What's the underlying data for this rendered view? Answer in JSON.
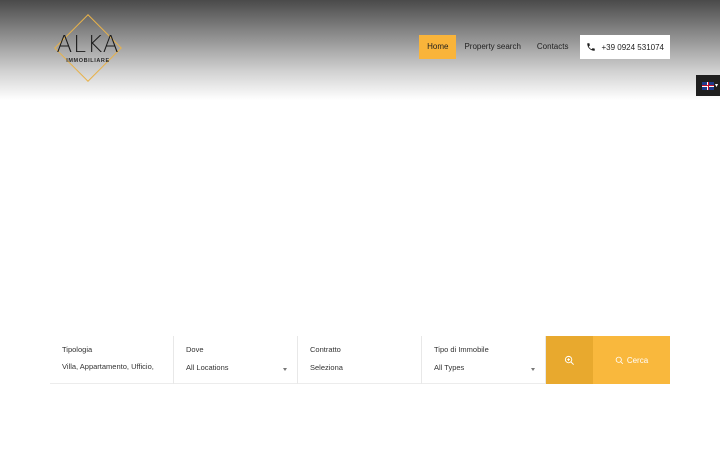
{
  "brand": {
    "name": "ALKA",
    "subtitle": "IMMOBILIARE",
    "accent": "#f9b43a"
  },
  "nav": {
    "items": [
      {
        "label": "Home",
        "active": true
      },
      {
        "label": "Property search",
        "active": false
      },
      {
        "label": "Contacts",
        "active": false
      }
    ],
    "phone": "+39 0924 531074",
    "phone_icon": "phone-icon"
  },
  "language": {
    "flag_icon": "uk-flag-icon"
  },
  "search": {
    "fields": [
      {
        "label": "Tipologia",
        "value": "Villa, Appartamento, Ufficio,"
      },
      {
        "label": "Dove",
        "value": "All Locations"
      },
      {
        "label": "Contratto",
        "value": "Seleziona"
      },
      {
        "label": "Tipo di Immobile",
        "value": "All Types"
      }
    ],
    "advanced_icon": "zoom-in-icon",
    "submit_label": "Cerca",
    "submit_icon": "search-icon"
  }
}
